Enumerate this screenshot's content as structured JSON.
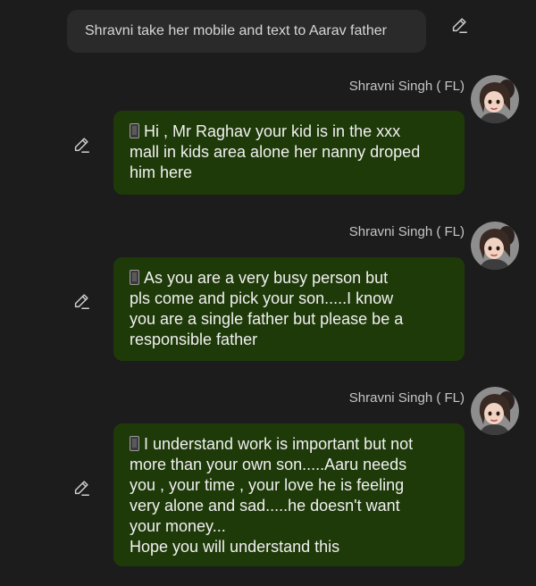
{
  "user_message": {
    "text": "Shravni take her mobile and text to Aarav father",
    "edit_icon": "pencil-icon"
  },
  "messages": [
    {
      "sender": "Shravni Singh ( FL)",
      "avatar_icon": "avatar-girl-icon",
      "edit_icon": "pencil-icon",
      "prefix_icon": "mobile-phone-icon",
      "lines": [
        "Hi , Mr Raghav your kid is in the xxx",
        "mall in kids area alone her nanny droped",
        "him here"
      ]
    },
    {
      "sender": "Shravni Singh ( FL)",
      "avatar_icon": "avatar-girl-icon",
      "edit_icon": "pencil-icon",
      "prefix_icon": "mobile-phone-icon",
      "lines": [
        "As you are a very busy person but",
        "pls come and pick your son.....I know",
        "you are a single father but please be a",
        "responsible father"
      ]
    },
    {
      "sender": "Shravni Singh ( FL)",
      "avatar_icon": "avatar-girl-icon",
      "edit_icon": "pencil-icon",
      "prefix_icon": "mobile-phone-icon",
      "lines": [
        "I understand work is important but not",
        "more than your own son.....Aaru needs",
        "you , your time , your love he is feeling",
        "very alone and sad.....he doesn't want",
        "your money...",
        "Hope you will understand this"
      ]
    }
  ],
  "colors": {
    "background": "#1c1c1c",
    "user_bubble": "#2a2a2a",
    "reply_bubble": "#1f3a09",
    "text": "#f0f0f0",
    "secondary_text": "#c6c6c6"
  }
}
